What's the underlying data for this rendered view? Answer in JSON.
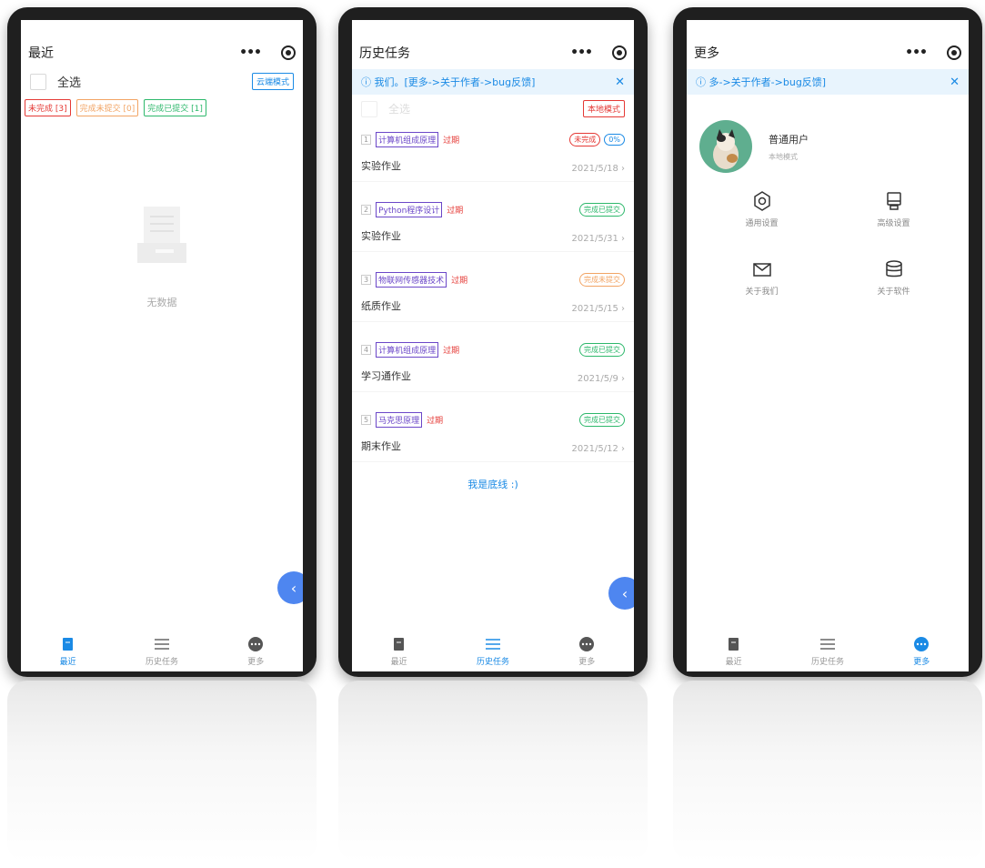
{
  "colors": {
    "accent": "#1a8ae5",
    "fab": "#4e86f0",
    "overdue": "#e53935",
    "course": "#6b47c8",
    "green": "#2db86b",
    "orange": "#f2a464",
    "red": "#e53935"
  },
  "phone1": {
    "title": "最近",
    "select_all": "全选",
    "mode_button": "云端模式",
    "filters": [
      "未完成 [3]",
      "完成未提交 [0]",
      "完成已提交 [1]"
    ],
    "empty_text": "无数据",
    "fab_icon": "chevron-left-icon",
    "tabs": [
      "最近",
      "历史任务",
      "更多"
    ],
    "active_tab": 0
  },
  "phone2": {
    "title": "历史任务",
    "notice": "ⓘ 我们。[更多->关于作者->bug反馈]",
    "select_all": "全选",
    "mode_button": "本地模式",
    "tasks": [
      {
        "index": "1",
        "course": "计算机组成原理",
        "overdue": "过期",
        "status": "未完成",
        "progress": "0%",
        "name": "实验作业",
        "date": "2021/5/18"
      },
      {
        "index": "2",
        "course": "Python程序设计",
        "overdue": "过期",
        "status": "完成已提交",
        "progress": "",
        "name": "实验作业",
        "date": "2021/5/31"
      },
      {
        "index": "3",
        "course": "物联网传感器技术",
        "overdue": "过期",
        "status": "完成未提交",
        "progress": "",
        "name": "纸质作业",
        "date": "2021/5/15"
      },
      {
        "index": "4",
        "course": "计算机组成原理",
        "overdue": "过期",
        "status": "完成已提交",
        "progress": "",
        "name": "学习通作业",
        "date": "2021/5/9"
      },
      {
        "index": "5",
        "course": "马克思原理",
        "overdue": "过期",
        "status": "完成已提交",
        "progress": "",
        "name": "期末作业",
        "date": "2021/5/12"
      }
    ],
    "footer": "我是底线 :)",
    "tabs": [
      "最近",
      "历史任务",
      "更多"
    ],
    "active_tab": 1
  },
  "phone3": {
    "title": "更多",
    "notice": "ⓘ 多->关于作者->bug反馈]",
    "user_name": "普通用户",
    "user_mode": "本地模式",
    "grid": [
      {
        "label": "通用设置",
        "icon": "gear-icon"
      },
      {
        "label": "高级设置",
        "icon": "device-icon"
      },
      {
        "label": "关于我们",
        "icon": "mail-icon"
      },
      {
        "label": "关于软件",
        "icon": "database-icon"
      }
    ],
    "tabs": [
      "最近",
      "历史任务",
      "更多"
    ],
    "active_tab": 2
  }
}
